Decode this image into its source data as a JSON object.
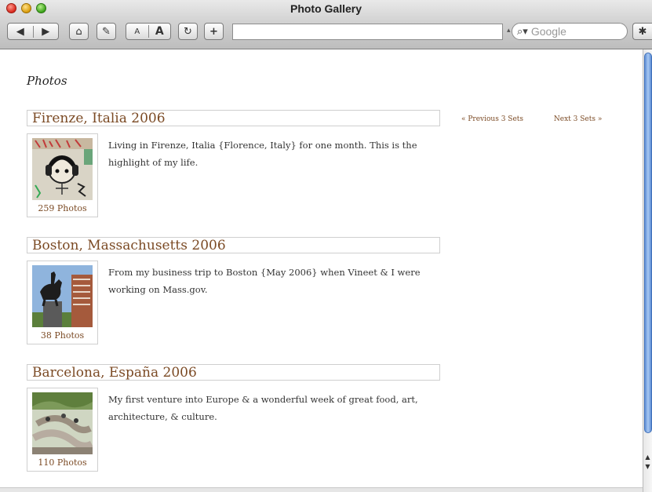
{
  "window": {
    "title": "Photo Gallery"
  },
  "toolbar": {
    "back_icon": "back-arrow-icon",
    "forward_icon": "forward-arrow-icon",
    "home_icon": "home-icon",
    "edit_icon": "edit-icon",
    "text_smaller": "A",
    "text_bigger": "A",
    "reload_icon": "reload-icon",
    "add_label": "+",
    "url_value": "",
    "search_placeholder": "Google",
    "bug_icon": "bug-icon"
  },
  "page": {
    "heading": "Photos",
    "pager": {
      "prev": "« Previous 3 Sets",
      "next": "Next 3 Sets »"
    },
    "sets": [
      {
        "title": "Firenze, Italia 2006",
        "count": "259 Photos",
        "description": "Living in Firenze, Italia {Florence, Italy} for one month. This is the highlight of my life."
      },
      {
        "title": "Boston, Massachusetts 2006",
        "count": "38 Photos",
        "description": "From my business trip to Boston {May 2006} when Vineet & I were working on Mass.gov."
      },
      {
        "title": "Barcelona, España 2006",
        "count": "110 Photos",
        "description": "My first venture into Europe & a wonderful week of great food, art, architecture, & culture."
      }
    ]
  },
  "colors": {
    "link": "#7b4a24",
    "scroll_thumb": "#6b9be0"
  }
}
